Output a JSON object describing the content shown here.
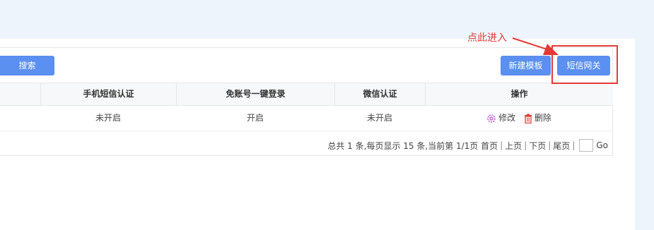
{
  "toolbar": {
    "search_label": "搜索",
    "new_template_label": "新建模板",
    "sms_gateway_label": "短信网关"
  },
  "table": {
    "headers": [
      "手机短信认证",
      "免账号一键登录",
      "微信认证",
      "操作"
    ],
    "rows": [
      {
        "sms_auth": "未开启",
        "one_click_login": "开启",
        "wechat_auth": "未开启",
        "edit_label": "修改",
        "delete_label": "删除"
      }
    ]
  },
  "pagination": {
    "summary": "总共 1 条,每页显示 15 条,当前第 1/1页",
    "first_label": "首页",
    "prev_label": "上页",
    "next_label": "下页",
    "last_label": "尾页",
    "go_label": "Go",
    "page_input_value": ""
  },
  "annotation": {
    "text": "点此进入",
    "color": "#e53935"
  },
  "colors": {
    "primary_button": "#5b8ff0",
    "edit_icon": "#c04fc0",
    "delete_icon": "#e53935"
  }
}
